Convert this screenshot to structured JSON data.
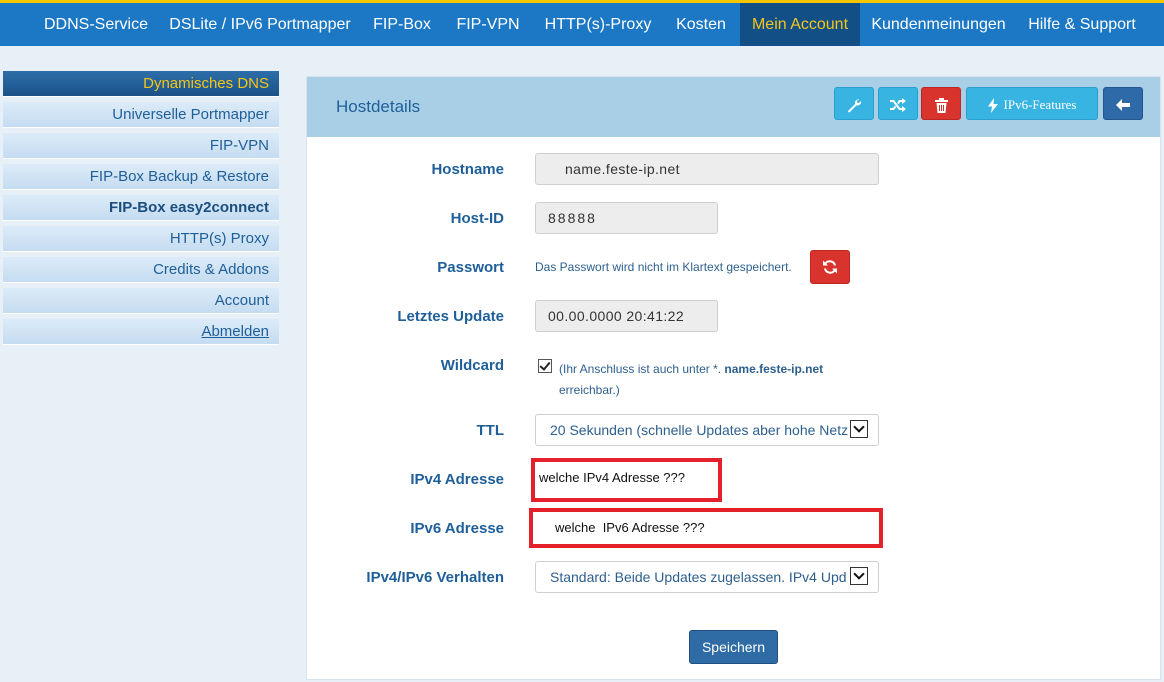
{
  "topnav": {
    "items": [
      {
        "label": "DDNS-Service"
      },
      {
        "label": "DSLite / IPv6 Portmapper"
      },
      {
        "label": "FIP-Box"
      },
      {
        "label": "FIP-VPN"
      },
      {
        "label": "HTTP(s)-Proxy"
      },
      {
        "label": "Kosten"
      },
      {
        "label": "Mein Account",
        "active": true
      },
      {
        "label": "Kundenmeinungen"
      },
      {
        "label": "Hilfe & Support"
      }
    ]
  },
  "sidebar": {
    "items": [
      {
        "label": "Dynamisches DNS",
        "active": true
      },
      {
        "label": "Universelle Portmapper"
      },
      {
        "label": "FIP-VPN"
      },
      {
        "label": "FIP-Box Backup & Restore"
      },
      {
        "label": "FIP-Box easy2connect"
      },
      {
        "label": "HTTP(s) Proxy"
      },
      {
        "label": "Credits & Addons"
      },
      {
        "label": "Account"
      },
      {
        "label": "Abmelden"
      }
    ]
  },
  "panel": {
    "title": "Hostdetails",
    "buttons": {
      "settings_icon": "wrench-icon",
      "shuffle_icon": "shuffle-icon",
      "delete_icon": "trash-icon",
      "ipv6_label": "IPv6-Features",
      "ipv6_icon": "bolt-icon",
      "back_icon": "arrow-left-icon"
    }
  },
  "form": {
    "hostname": {
      "label": "Hostname",
      "value": "name.feste-ip.net"
    },
    "hostid": {
      "label": "Host-ID",
      "value": "88888"
    },
    "password": {
      "label": "Passwort",
      "note": "Das Passwort wird nicht im Klartext gespeichert.",
      "refresh_icon": "refresh-icon"
    },
    "last_update": {
      "label": "Letztes Update",
      "value": "00.00.0000 20:41:22"
    },
    "wildcard": {
      "label": "Wildcard",
      "checked": true,
      "text_before": "(Ihr Anschluss ist auch unter *.",
      "host": "name.feste-ip.net",
      "text_after": "erreichbar.)"
    },
    "ttl": {
      "label": "TTL",
      "value": "20 Sekunden (schnelle Updates aber hohe Netz"
    },
    "ipv4": {
      "label": "IPv4 Adresse",
      "value": "welche IPv4 Adresse ???"
    },
    "ipv6": {
      "label": "IPv6 Adresse",
      "value": "welche  IPv6 Adresse ???"
    },
    "behaviour": {
      "label": "IPv4/IPv6 Verhalten",
      "value": "Standard: Beide Updates zugelassen. IPv4 Upd"
    },
    "save_label": "Speichern"
  },
  "colors": {
    "nav_bg": "#1c78c4",
    "nav_active_bg": "#124f86",
    "accent_yellow": "#f5c518",
    "label_blue": "#1f5f99",
    "danger_red": "#d9332d",
    "highlight_red": "#e4202b",
    "header_bg": "#a9cfe7"
  }
}
